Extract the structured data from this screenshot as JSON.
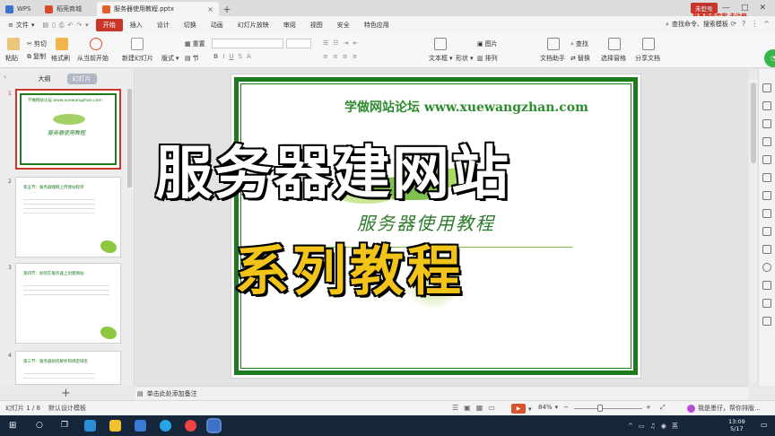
{
  "titlebar": {
    "app_tab": "WPS",
    "store_tab": "稻壳商城",
    "doc_tab": "服务器使用教程.pptx",
    "login_label": "未登录",
    "promo_text": "屏幕录像专家 未注册"
  },
  "menu": {
    "file_label": "文件",
    "items": [
      "开始",
      "插入",
      "设计",
      "切换",
      "动画",
      "幻灯片放映",
      "审阅",
      "视图",
      "安全",
      "特色应用"
    ],
    "active_item": "开始",
    "search_label": "查找命令、搜索模板"
  },
  "ribbon": {
    "cut": "剪切",
    "copy": "复制",
    "format_painter": "格式刷",
    "paste": "粘贴",
    "from_current": "从当前开始",
    "new_slide": "新建幻灯片",
    "layout": "版式",
    "section": "节",
    "reset": "重置",
    "textbox": "文本框",
    "shapes": "形状",
    "arrange": "排列",
    "picture": "图片",
    "doc_helper": "文档助手",
    "find": "查找",
    "replace": "替换",
    "select_pane": "选择窗格",
    "share_doc": "分享文档"
  },
  "leftpane": {
    "tab_outline": "大纲",
    "tab_slides": "幻灯片",
    "thumbs": [
      {
        "num": "1",
        "title": "服务器使用教程",
        "subtitle": "学做网站论坛 www.xuewangzhan.com"
      },
      {
        "num": "2",
        "title": "第五节：服务器端网上传建站程序"
      },
      {
        "num": "3",
        "title": "第四节：如何在服务器上创建网站"
      },
      {
        "num": "4",
        "title": "第三节：服务器如何解析和绑定域名"
      }
    ]
  },
  "slide": {
    "header": "学做网站论坛 www.xuewangzhan.com",
    "title": "服务器使用教程"
  },
  "overlay": {
    "caption_main": "服务器建网站",
    "caption_sub": "系列教程"
  },
  "notes": {
    "placeholder": "单击此处添加备注"
  },
  "status": {
    "slide_count": "幻灯片 1 / 8",
    "template": "默认设计模板",
    "zoom": "84%",
    "assistant": "我是墨仔，帮你排版..."
  },
  "taskbar": {
    "time": "13:09",
    "date": "5/17"
  },
  "colors": {
    "accent": "#c8362b",
    "slide_green": "#1f7a1f",
    "caption_yellow": "#f2c318",
    "taskbar": "#16263b"
  }
}
